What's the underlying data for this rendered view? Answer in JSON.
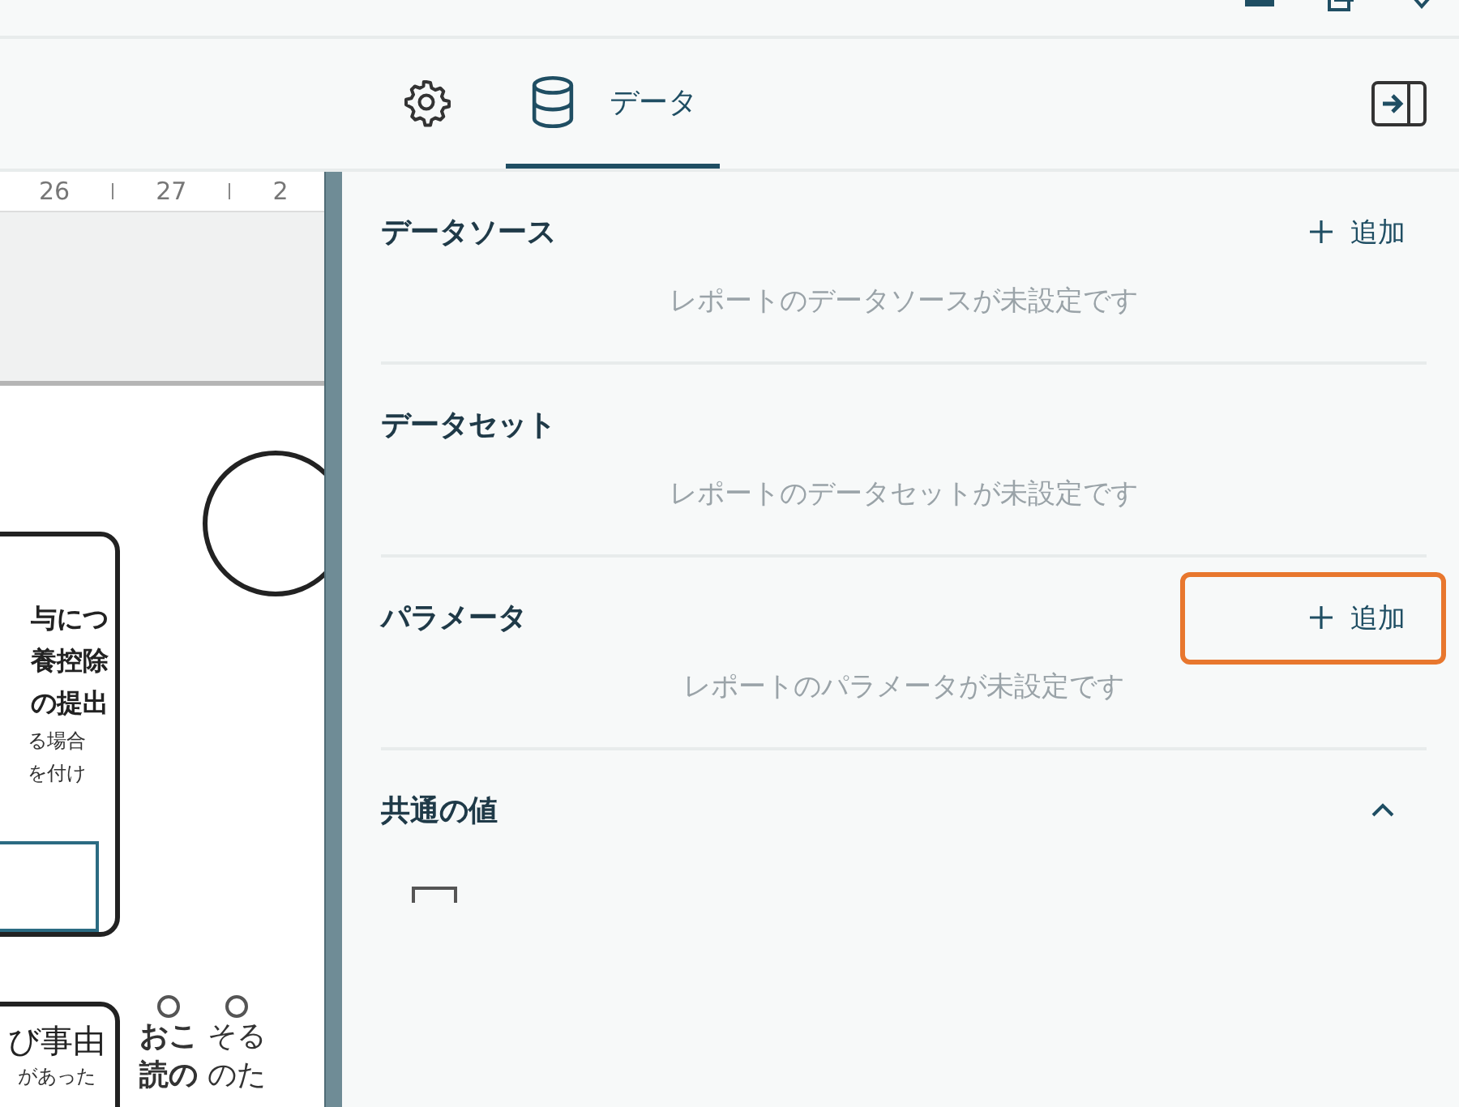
{
  "tabs": [
    {
      "kind": "settings",
      "selected": false
    },
    {
      "kind": "data",
      "label": "データ",
      "selected": true
    }
  ],
  "ruler": [
    "26",
    "27",
    "2"
  ],
  "document": {
    "box_lines": [
      "与につ",
      "養控除",
      "の提出"
    ],
    "box_notes": [
      "る場合",
      "を付け"
    ],
    "lower_box": [
      "び事由",
      "があった"
    ],
    "columns": [
      [
        "おこ",
        "読の"
      ],
      [
        "そる",
        "のた"
      ]
    ]
  },
  "sections": [
    {
      "title": "データソース",
      "add": "追加",
      "highlighted": false,
      "empty": "レポートのデータソースが未設定です"
    },
    {
      "title": "データセット",
      "empty": "レポートのデータセットが未設定です"
    },
    {
      "title": "パラメータ",
      "add": "追加",
      "highlighted": true,
      "empty": "レポートのパラメータが未設定です"
    },
    {
      "title": "共通の値",
      "expanded": true
    }
  ]
}
